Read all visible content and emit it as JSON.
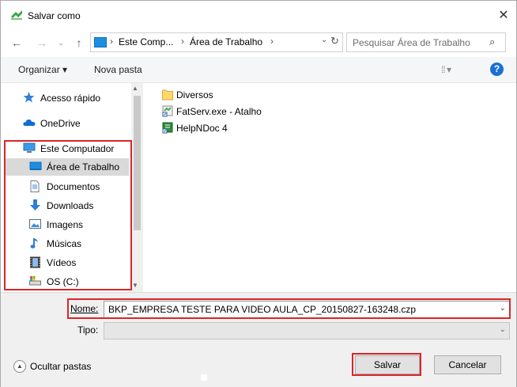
{
  "window": {
    "title": "Salvar como",
    "close_glyph": "✕"
  },
  "nav": {
    "back": "←",
    "forward": "→",
    "up": "↑"
  },
  "address": {
    "seg1": "Este Comp...",
    "seg2": "Área de Trabalho",
    "sep": "›",
    "dropdown": "⌄",
    "refresh": "↻"
  },
  "search": {
    "placeholder": "Pesquisar Área de Trabalho",
    "icon": "⌕"
  },
  "toolbar": {
    "organize": "Organizar ▾",
    "new_folder": "Nova pasta",
    "view": "⁞⁞ ▾",
    "help": "?"
  },
  "sidebar": {
    "items": [
      {
        "label": "Acesso rápido",
        "icon": "star-icon"
      },
      {
        "label": "OneDrive",
        "icon": "cloud-icon"
      },
      {
        "label": "Este Computador",
        "icon": "computer-icon"
      },
      {
        "label": "Área de Trabalho",
        "icon": "desktop-icon"
      },
      {
        "label": "Documentos",
        "icon": "document-icon"
      },
      {
        "label": "Downloads",
        "icon": "download-icon"
      },
      {
        "label": "Imagens",
        "icon": "image-icon"
      },
      {
        "label": "Músicas",
        "icon": "music-icon"
      },
      {
        "label": "Vídeos",
        "icon": "video-icon"
      },
      {
        "label": "OS (C:)",
        "icon": "drive-icon"
      }
    ]
  },
  "files": [
    {
      "label": "Diversos",
      "icon": "folder-icon"
    },
    {
      "label": "FatServ.exe - Atalho",
      "icon": "shortcut-icon"
    },
    {
      "label": "HelpNDoc 4",
      "icon": "shortcut-icon"
    }
  ],
  "form": {
    "name_label": "Nome:",
    "name_value": "BKP_EMPRESA TESTE PARA VIDEO AULA_CP_20150827-163248.czp",
    "type_label": "Tipo:",
    "dropdown_glyph": "⌄"
  },
  "buttons": {
    "hide_folders": "Ocultar pastas",
    "hide_glyph": "▲",
    "save": "Salvar",
    "cancel": "Cancelar"
  },
  "colors": {
    "highlight": "#d9262a",
    "selected": "#d9d9d9",
    "accent": "#1a6fd3"
  }
}
